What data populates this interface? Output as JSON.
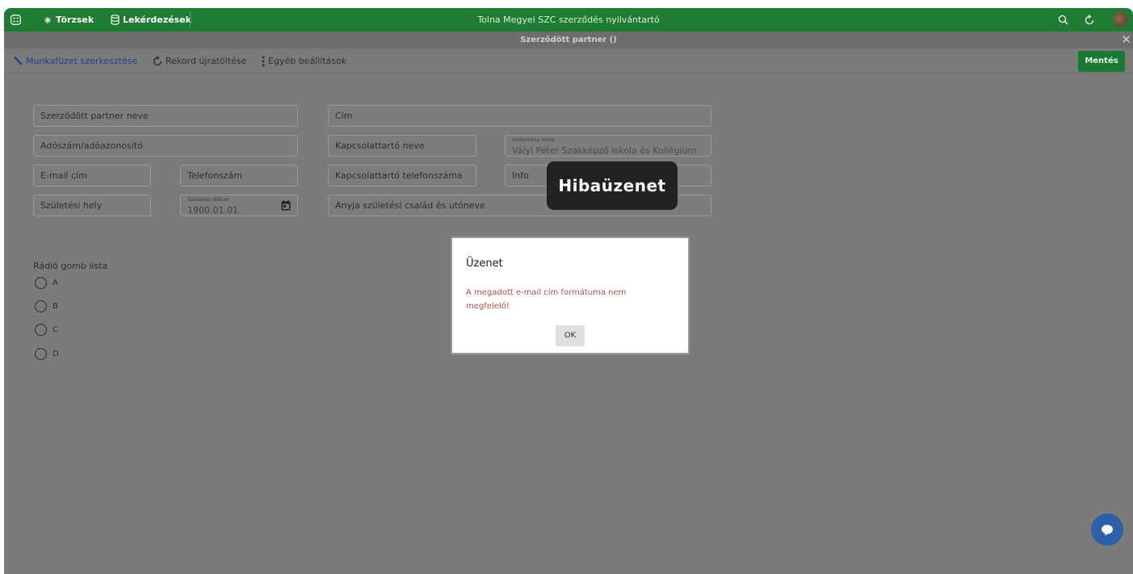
{
  "topbar": {
    "menu_torzsek": "Törzsek",
    "menu_lekerdezesek": "Lekérdezések",
    "app_title": "Tolna Megyei SZC szerződés nyilvántartó"
  },
  "subbar": {
    "title": "Szerződött partner ()"
  },
  "toolbar": {
    "edit_workbook": "Munkafüzet szerkesztése",
    "reload_record": "Rekord újratöltése",
    "other_settings": "Egyéb beállítások",
    "save": "Mentés"
  },
  "form": {
    "partner_name": "Szerződött partner neve",
    "address": "Cím",
    "tax_id": "Adószám/adóazonosító",
    "contact_name": "Kapcsolattartó neve",
    "institution_label": "Intézmény neve",
    "institution_value": "Vályi Péter Szakképző Iskola és Kollégium",
    "email": "E-mail cím",
    "phone": "Telefonszám",
    "contact_phone": "Kapcsolattartó telefonszáma",
    "info": "Info",
    "birth_place": "Születési hely",
    "birth_date_label": "Születési dátum",
    "birth_date_value": "1900.01.01.",
    "mother_name": "Anyja születési család és utóneve"
  },
  "radio": {
    "title": "Rádió gomb lista",
    "options": [
      "A",
      "B",
      "C",
      "D"
    ]
  },
  "tooltip": {
    "text": "Hibaüzenet"
  },
  "dialog": {
    "title": "Üzenet",
    "message": "A megadott e-mail cím formátuma nem megfelelő!",
    "ok": "OK"
  },
  "colors": {
    "topbar": "#1e7d33",
    "save_button": "#197a32",
    "error_text": "#b5504b",
    "chat_button": "#2e5fab"
  }
}
